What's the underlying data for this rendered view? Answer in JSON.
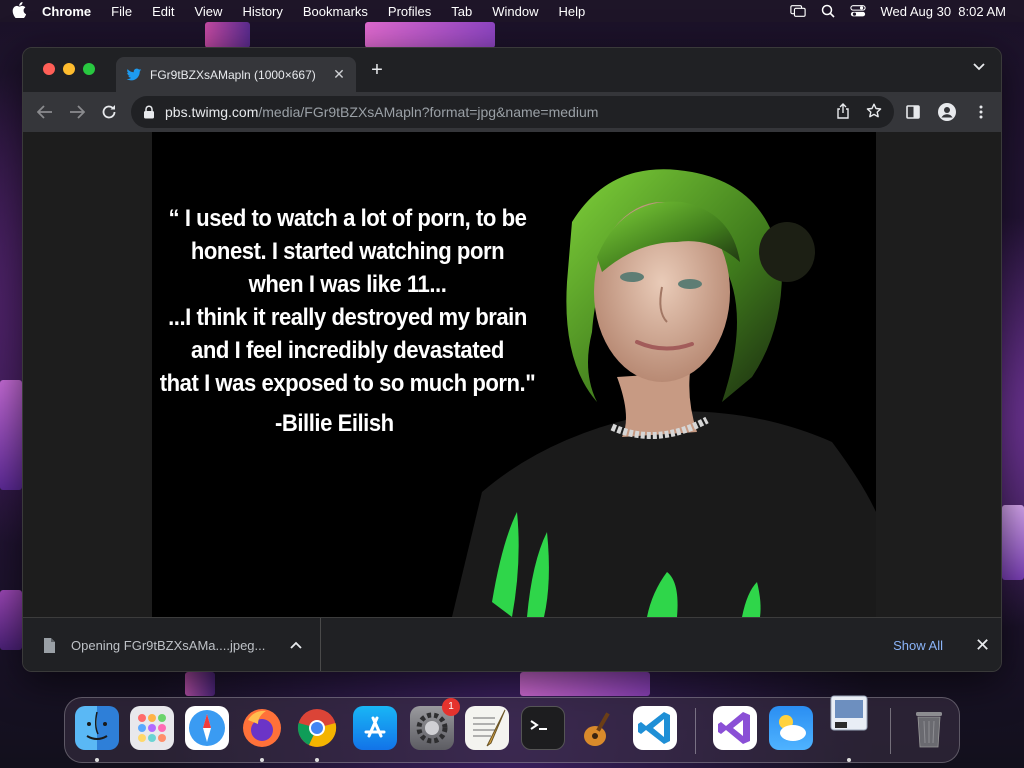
{
  "menubar": {
    "app_name": "Chrome",
    "items": [
      "File",
      "Edit",
      "View",
      "History",
      "Bookmarks",
      "Profiles",
      "Tab",
      "Window",
      "Help"
    ],
    "clock": "Wed Aug 30  8:02 AM"
  },
  "browser": {
    "tab": {
      "title": "FGr9tBZXsAMapln (1000×667)",
      "favicon": "twitter-bird-icon"
    },
    "address": {
      "host": "pbs.twimg.com",
      "path": "/media/FGr9tBZXsAMapln?format=jpg&name=medium"
    }
  },
  "image": {
    "quote_lines": [
      "“ I used to watch a lot of porn, to be",
      "honest. I started watching porn",
      "when I was like 11...",
      "...I think it really destroyed my brain",
      "and I feel incredibly devastated",
      "that I was exposed to so much porn.\""
    ],
    "author": "-Billie Eilish"
  },
  "download_bar": {
    "item_text": "Opening FGr9tBZXsAMa....jpeg...",
    "show_all": "Show All"
  },
  "dock": {
    "apps": [
      "finder",
      "launchpad",
      "safari",
      "firefox",
      "chrome",
      "app-store",
      "system-settings",
      "textedit",
      "terminal",
      "garageband",
      "vscode",
      "visual-studio",
      "weather",
      "preview",
      "trash"
    ],
    "settings_badge": "1"
  },
  "colors": {
    "accent_link": "#8ab4f8",
    "tab_bg": "#35363a",
    "window_bg": "#202124"
  }
}
